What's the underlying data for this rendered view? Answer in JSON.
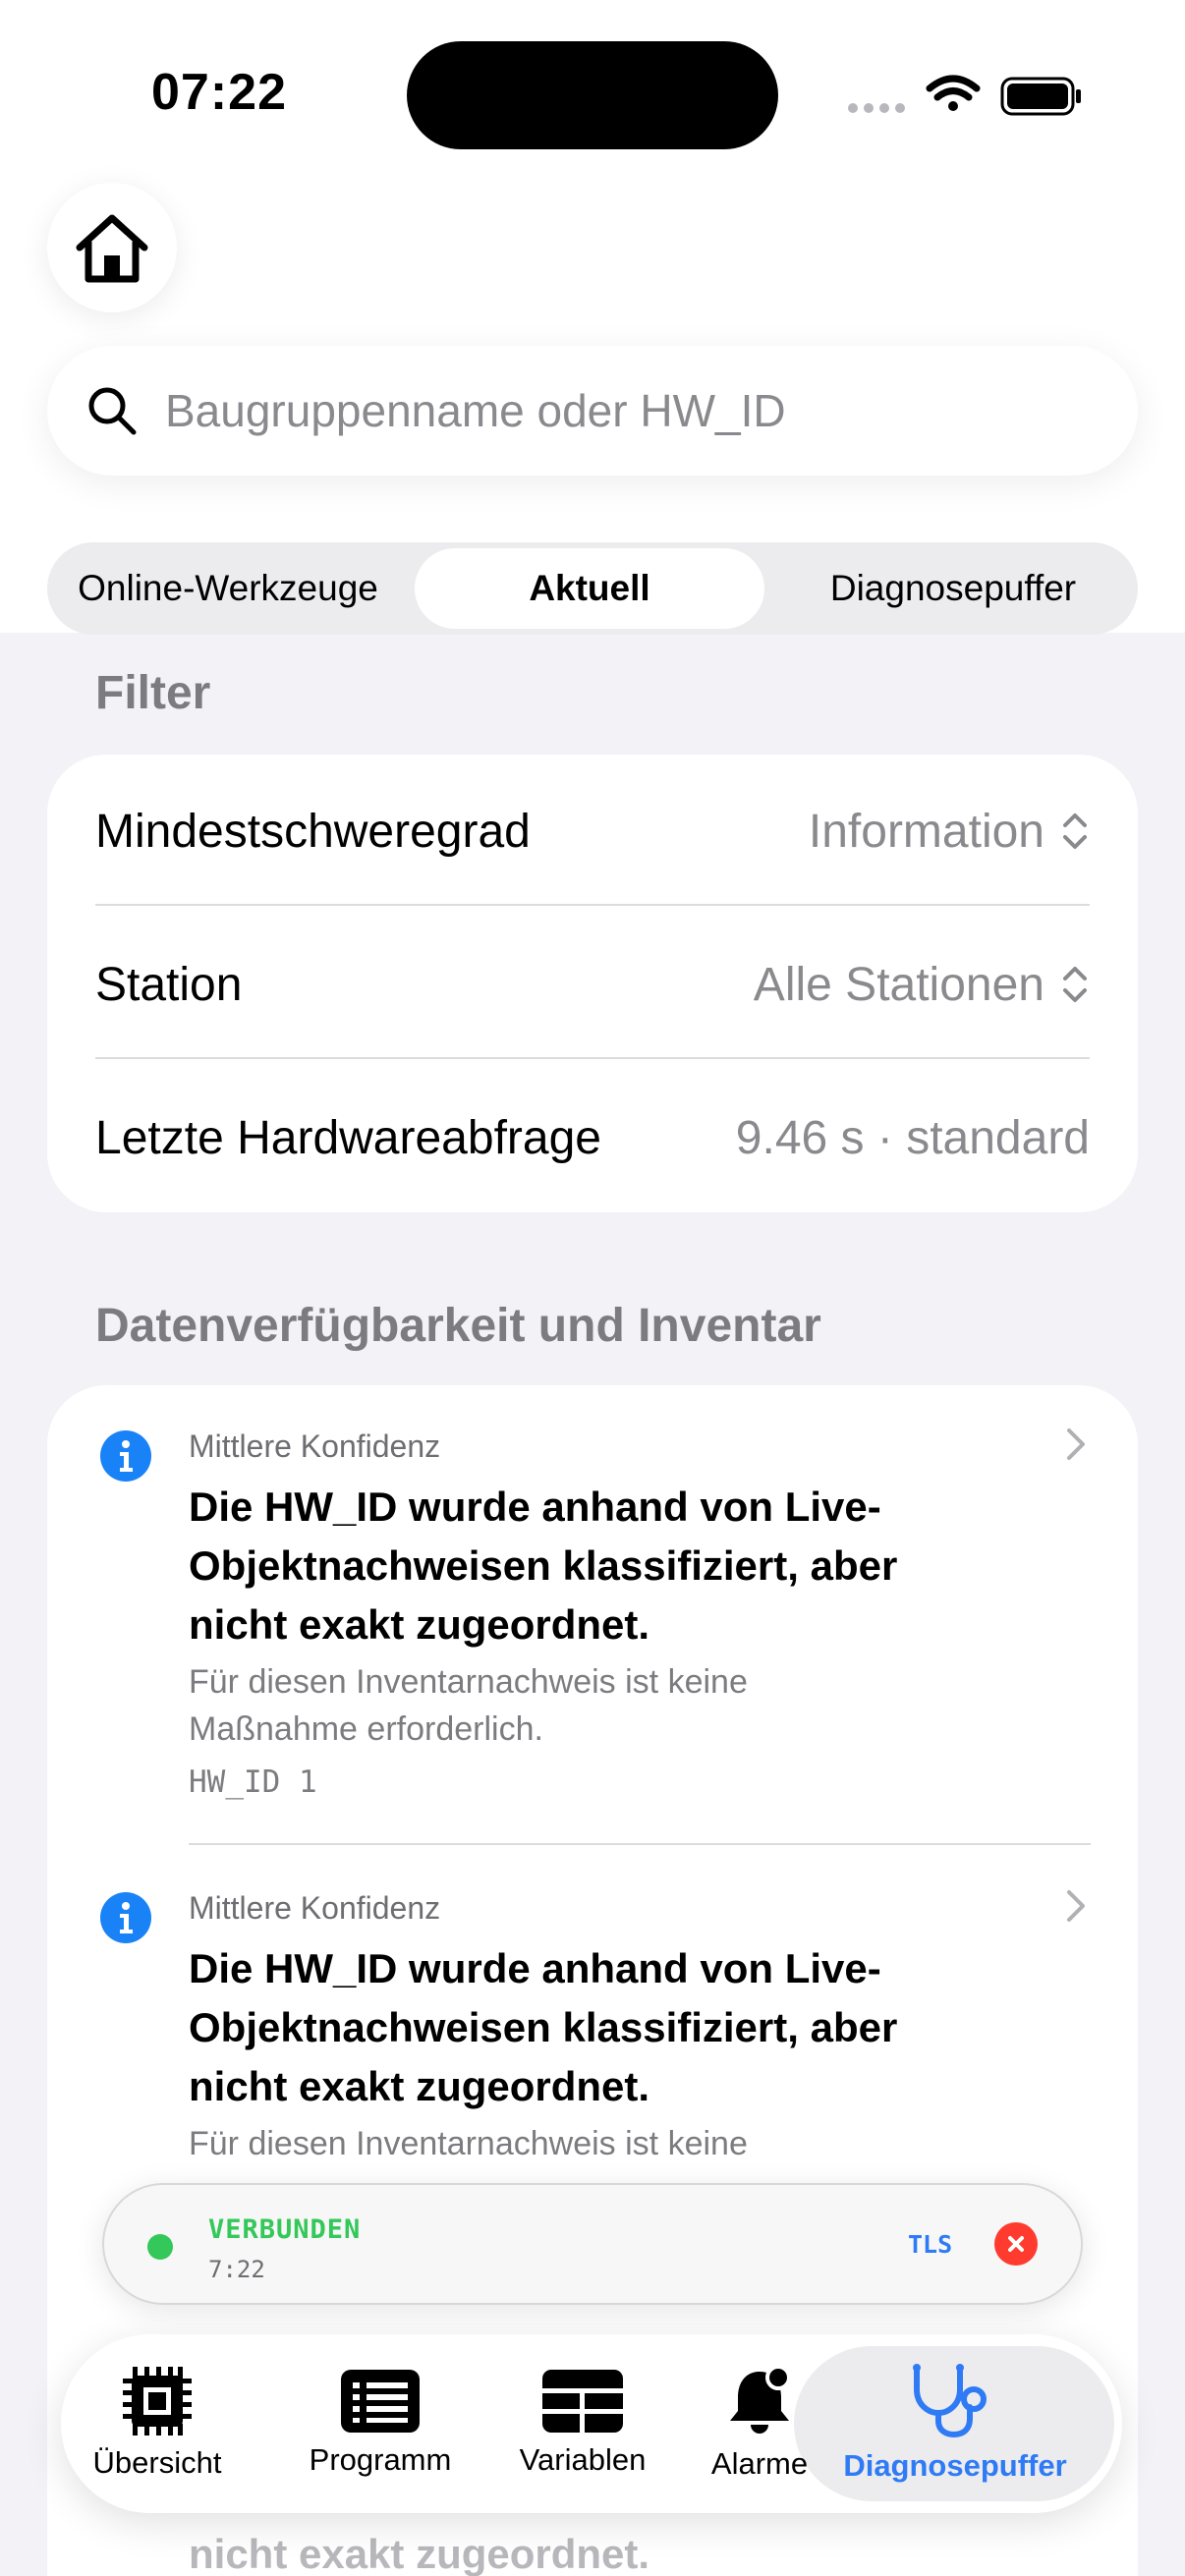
{
  "status_bar": {
    "time": "07:22"
  },
  "search": {
    "placeholder": "Baugruppenname oder HW_ID"
  },
  "segments": [
    {
      "label": "Online-Werkzeuge"
    },
    {
      "label": "Aktuell"
    },
    {
      "label": "Diagnosepuffer"
    }
  ],
  "filter": {
    "title": "Filter",
    "rows": [
      {
        "label": "Mindestschweregrad",
        "value": "Information"
      },
      {
        "label": "Station",
        "value": "Alle Stationen"
      },
      {
        "label": "Letzte Hardwareabfrage",
        "value": "9.46 s · standard"
      }
    ]
  },
  "inventory": {
    "title": "Datenverfügbarkeit und Inventar",
    "items": [
      {
        "confidence": "Mittlere Konfidenz",
        "headline_lines": [
          "Die HW_ID wurde anhand von Live-",
          "Objektnachweisen klassifiziert, aber",
          "nicht exakt zugeordnet."
        ],
        "sub_lines": [
          "Für diesen Inventarnachweis ist keine",
          "Maßnahme erforderlich."
        ],
        "hw_id": "HW_ID 1"
      },
      {
        "confidence": "Mittlere Konfidenz",
        "headline_lines": [
          "Die HW_ID wurde anhand von Live-",
          "Objektnachweisen klassifiziert, aber",
          "nicht exakt zugeordnet."
        ],
        "sub_lines": [
          "Für diesen Inventarnachweis ist keine"
        ]
      }
    ],
    "partial_tail": "nicht exakt zugeordnet."
  },
  "connection": {
    "status": "VERBUNDEN",
    "time": "7:22",
    "protocol": "TLS"
  },
  "tabs": [
    {
      "label": "Übersicht",
      "icon": "chip-icon"
    },
    {
      "label": "Programm",
      "icon": "list-icon"
    },
    {
      "label": "Variablen",
      "icon": "table-icon"
    },
    {
      "label": "Alarme",
      "icon": "bell-icon"
    },
    {
      "label": "Diagnosepuffer",
      "icon": "stethoscope-icon"
    }
  ],
  "colors": {
    "accent": "#2f7bf5",
    "connected": "#34c759",
    "danger": "#ff3b30",
    "info": "#1a82f7"
  }
}
